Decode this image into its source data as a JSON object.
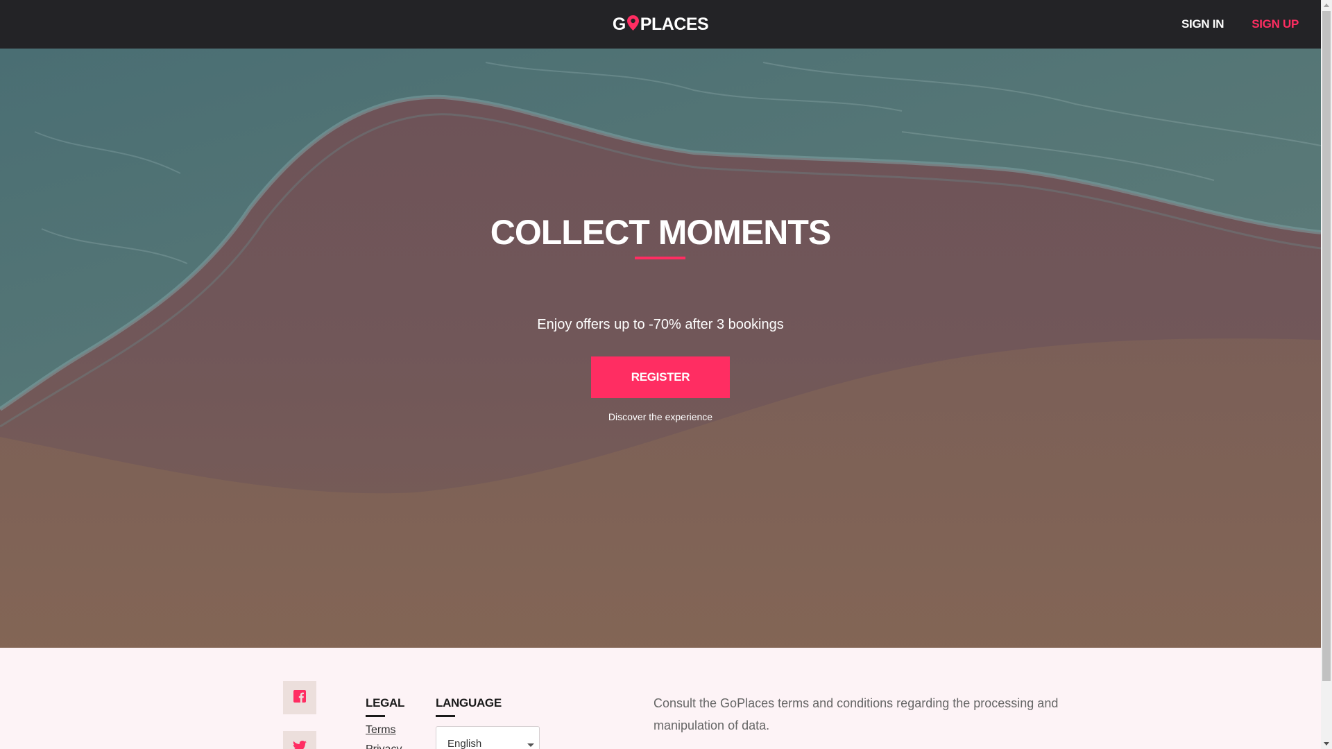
{
  "header": {
    "logo_left": "G",
    "logo_right": "PLACES",
    "sign_in": "SIGN IN",
    "sign_up": "SIGN UP"
  },
  "hero": {
    "title": "COLLECT MOMENTS",
    "subtitle": "Enjoy offers up to -70% after 3 bookings",
    "register": "REGISTER",
    "discover": "Discover the experience"
  },
  "footer": {
    "social": [
      {
        "icon": "facebook-icon"
      },
      {
        "icon": "twitter-icon"
      }
    ],
    "legal_title": "LEGAL",
    "legal_links": [
      "Terms",
      "Privacy"
    ],
    "language_title": "LANGUAGE",
    "language_value": "English",
    "description": "Consult the GoPlaces terms and conditions regarding the processing and manipulation of data."
  },
  "colors": {
    "accent": "#ff2d62",
    "header_bg": "#232326",
    "footer_bg": "#fdf3f6"
  }
}
